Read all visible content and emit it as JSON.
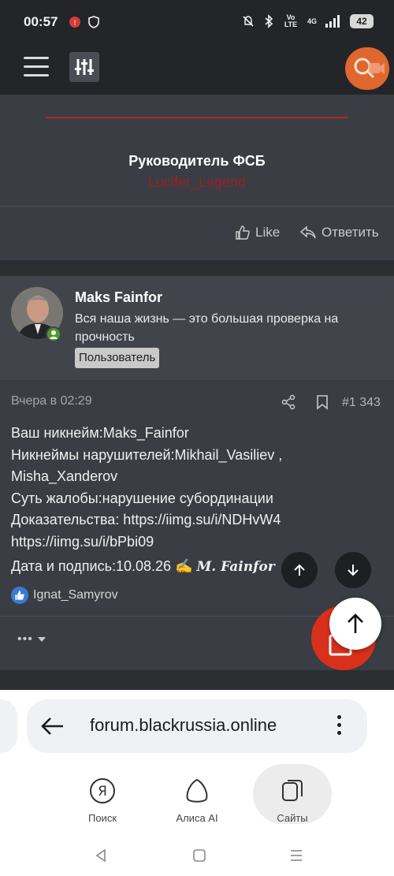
{
  "statusbar": {
    "time": "00:57",
    "network_label": "Vo LTE",
    "signal_label": "4G",
    "battery": "42"
  },
  "top_post": {
    "signature_title": "Руководитель ФСБ",
    "signature_name": "Lucifer_Legend",
    "like_label": "Like",
    "reply_label": "Ответить"
  },
  "post": {
    "author": "Maks Fainfor",
    "author_title": "Вся наша жизнь — это большая проверка на прочность",
    "author_badge": "Пользователь",
    "date": "Вчера в 02:29",
    "number": "#1 343",
    "lines": {
      "l1": "Ваш никнейм:Maks_Fainfor",
      "l2": "Никнеймы нарушителей:Mikhail_Vasiliev ,",
      "l3": "Misha_Xanderov",
      "l4": "Суть жалобы:нарушение субординации",
      "l5": "Доказательства: https://iimg.su/i/NDHvW4",
      "l6": "https://iimg.su/i/bPbi09",
      "l7": "Дата и подпись:10.08.26 ✍️",
      "signature": "M. Fainfor"
    },
    "reacted_user": "Ignat_Samyrov",
    "more_label": "•••"
  },
  "browser": {
    "url": "forum.blackrussia.online",
    "nav": {
      "search": "Поиск",
      "alice": "Алиса AI",
      "sites": "Сайты"
    }
  },
  "colors": {
    "accent_red": "#b3262a",
    "fab_red": "#d9301c",
    "search_orange": "#e0672e",
    "online_green": "#4e9a2e"
  }
}
